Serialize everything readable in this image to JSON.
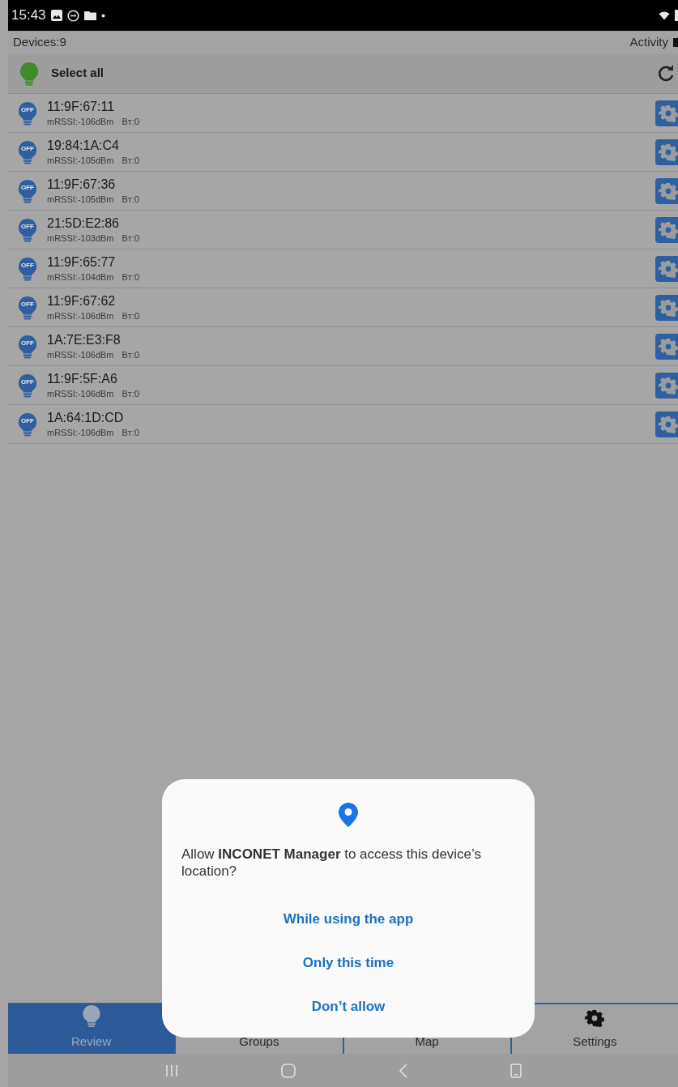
{
  "status_bar": {
    "time": "15:43"
  },
  "header": {
    "devices": "Devices:9",
    "activity": "Activity",
    "activity_checked": true
  },
  "select_all": {
    "label": "Select all"
  },
  "devices": [
    {
      "address": "11:9F:67:11",
      "rssi": "mRSSI:-106dBm",
      "bt": "Bт:0",
      "status": "OFF",
      "on": false
    },
    {
      "address": "19:84:1A:C4",
      "rssi": "mRSSI:-105dBm",
      "bt": "Bт:0",
      "status": "OFF",
      "on": false
    },
    {
      "address": "11:9F:67:36",
      "rssi": "mRSSI:-105dBm",
      "bt": "Bт:0",
      "status": "OFF",
      "on": false
    },
    {
      "address": "21:5D:E2:86",
      "rssi": "mRSSI:-103dBm",
      "bt": "Bт:0",
      "status": "OFF",
      "on": false
    },
    {
      "address": "11:9F:65:77",
      "rssi": "mRSSI:-104dBm",
      "bt": "Bт:0",
      "status": "OFF",
      "on": false
    },
    {
      "address": "11:9F:67:62",
      "rssi": "mRSSI:-106dBm",
      "bt": "Bт:0",
      "status": "OFF",
      "on": false
    },
    {
      "address": "1A:7E:E3:F8",
      "rssi": "mRSSI:-106dBm",
      "bt": "Bт:0",
      "status": "OFF",
      "on": false
    },
    {
      "address": "11:9F:5F:A6",
      "rssi": "mRSSI:-106dBm",
      "bt": "Bт:0",
      "status": "OFF",
      "on": false
    },
    {
      "address": "1A:64:1D:CD",
      "rssi": "mRSSI:-106dBm",
      "bt": "Bт:0",
      "status": "OFF",
      "on": false
    }
  ],
  "tabs": [
    {
      "label": "Review",
      "kind": "bulb",
      "selected": true
    },
    {
      "label": "Groups",
      "kind": "none",
      "selected": false
    },
    {
      "label": "Map",
      "kind": "none",
      "selected": false
    },
    {
      "label": "Settings",
      "kind": "gear",
      "selected": false
    }
  ],
  "dialog": {
    "message": "Allow **INCONET Manager** to access this device’s location?",
    "buttons": [
      "While using the app",
      "Only this time",
      "Don’t allow"
    ]
  }
}
